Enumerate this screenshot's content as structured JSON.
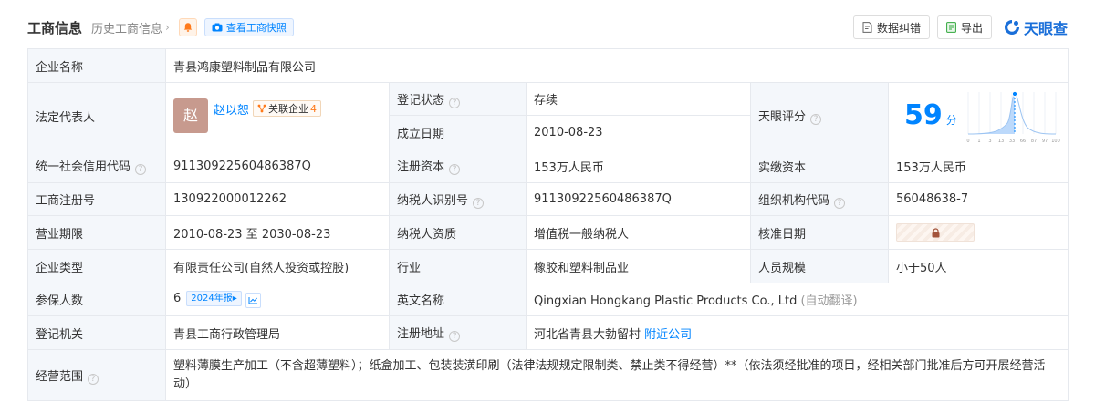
{
  "header": {
    "title": "工商信息",
    "history": "历史工商信息",
    "snapshot": "查看工商快照",
    "correct": "数据纠错",
    "export": "导出",
    "logo": "天眼查"
  },
  "colors": {
    "accent": "#0084ff",
    "green": "#2fa73a",
    "orange": "#ff7a1a"
  },
  "table": {
    "company_name_label": "企业名称",
    "company_name": "青县鸿康塑料制品有限公司",
    "legal_rep_label": "法定代表人",
    "legal_rep_avatar": "赵",
    "legal_rep_name": "赵以恕",
    "related_label": "关联企业",
    "related_count": "4",
    "reg_status_label": "登记状态",
    "reg_status": "存续",
    "founded_label": "成立日期",
    "founded": "2010-08-23",
    "tianyan_label": "天眼评分",
    "score": "59",
    "score_unit": "分",
    "credit_code_label": "统一社会信用代码",
    "credit_code": "91130922560486387Q",
    "reg_capital_label": "注册资本",
    "reg_capital": "153万人民币",
    "paid_capital_label": "实缴资本",
    "paid_capital": "153万人民币",
    "reg_no_label": "工商注册号",
    "reg_no": "130922000012262",
    "taxpayer_id_label": "纳税人识别号",
    "taxpayer_id": "91130922560486387Q",
    "org_code_label": "组织机构代码",
    "org_code": "56048638-7",
    "term_label": "营业期限",
    "term": "2010-08-23 至 2030-08-23",
    "taxpayer_qual_label": "纳税人资质",
    "taxpayer_qual": "增值税一般纳税人",
    "approve_label": "核准日期",
    "type_label": "企业类型",
    "type": "有限责任公司(自然人投资或控股)",
    "industry_label": "行业",
    "industry": "橡胶和塑料制品业",
    "staff_label": "人员规模",
    "staff": "小于50人",
    "insured_label": "参保人数",
    "insured": "6",
    "report_tag": "2024年报",
    "english_label": "英文名称",
    "english": "Qingxian Hongkang Plastic Products Co., Ltd",
    "auto_translate": "(自动翻译)",
    "authority_label": "登记机关",
    "authority": "青县工商行政管理局",
    "address_label": "注册地址",
    "address": "河北省青县大勃留村",
    "nearby": "附近公司",
    "scope_label": "经营范围",
    "scope": "塑料薄膜生产加工（不含超薄塑料）；纸盒加工、包装装潢印刷（法律法规规定限制类、禁止类不得经营）**（依法须经批准的项目，经相关部门批准后方可开展经营活动）"
  },
  "score_chart": {
    "ticks": [
      "0",
      "1",
      "3",
      "13",
      "33",
      "66",
      "87",
      "97",
      "100"
    ],
    "score": 59
  }
}
